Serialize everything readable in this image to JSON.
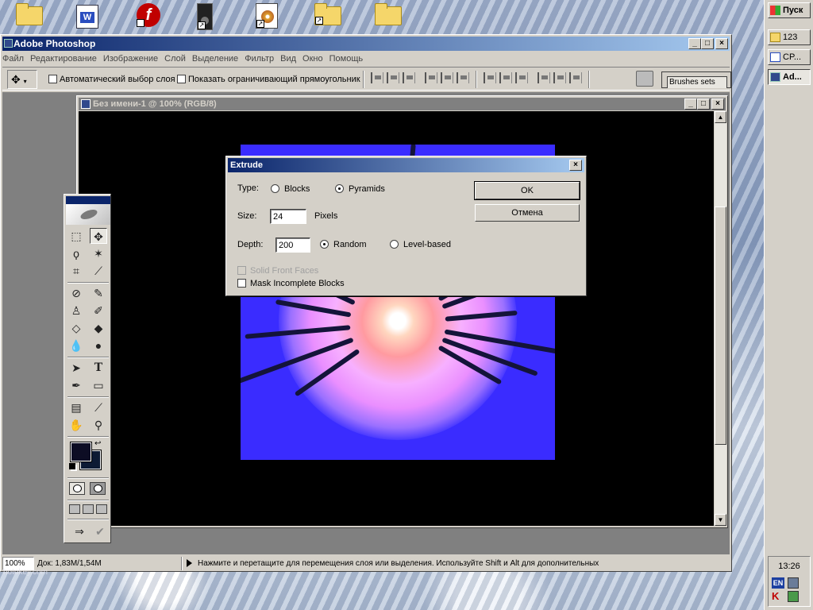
{
  "desktop": {
    "icons": [
      "folder-open-icon",
      "word-doc-icon",
      "flash-icon",
      "speaker-icon",
      "cd-icon",
      "folder-icon",
      "folder-icon"
    ],
    "watermark": "hotokey.com"
  },
  "taskbar": {
    "start_label": "Пуск",
    "items": [
      {
        "label": "123",
        "icon": "folder-icon"
      },
      {
        "label": "CP...",
        "icon": "word-doc-icon"
      },
      {
        "label": "Ad...",
        "icon": "photoshop-icon"
      }
    ],
    "clock": "13:26",
    "lang": "EN",
    "tray_k": "K"
  },
  "photoshop": {
    "title": "Adobe Photoshop",
    "menu": [
      "Файл",
      "Редактирование",
      "Изображение",
      "Слой",
      "Выделение",
      "Фильтр",
      "Вид",
      "Окно",
      "Помощь"
    ],
    "options": {
      "auto_select": "Автоматический выбор слоя",
      "show_bounds": "Показать ограничивающий прямоугольник",
      "brushes_tab": "Brushes   sets"
    },
    "document": {
      "title": "Без имени-1 @ 100% (RGB/8)"
    },
    "status": {
      "zoom": "100%",
      "doc_size": "Док: 1,83M/1,54M",
      "hint": "Нажмите и перетащите для перемещения слоя или выделения. Используйте Shift и Alt для дополнительных"
    }
  },
  "dialog": {
    "title": "Extrude",
    "type_label": "Type:",
    "type_options": [
      "Blocks",
      "Pyramids"
    ],
    "type_selected": "Pyramids",
    "size_label": "Size:",
    "size_value": "24",
    "size_unit": "Pixels",
    "depth_label": "Depth:",
    "depth_value": "200",
    "depth_options": [
      "Random",
      "Level-based"
    ],
    "depth_selected": "Random",
    "solid_front_faces": "Solid Front Faces",
    "mask_incomplete": "Mask Incomplete Blocks",
    "ok": "OK",
    "cancel": "Отмена"
  }
}
